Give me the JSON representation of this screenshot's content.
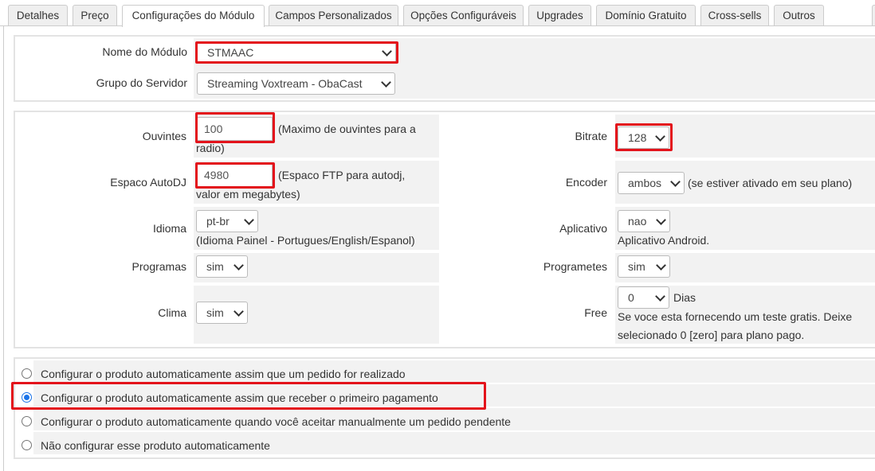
{
  "tabs": [
    {
      "label": "Detalhes",
      "active": false
    },
    {
      "label": "Preço",
      "active": false
    },
    {
      "label": "Configurações do Módulo",
      "active": true
    },
    {
      "label": "Campos Personalizados",
      "active": false
    },
    {
      "label": "Opções Configuráveis",
      "active": false
    },
    {
      "label": "Upgrades",
      "active": false
    },
    {
      "label": "Domínio Gratuito",
      "active": false
    },
    {
      "label": "Cross-sells",
      "active": false
    },
    {
      "label": "Outros",
      "active": false
    }
  ],
  "module": {
    "module_name_label": "Nome do Módulo",
    "module_name_value": "STMAAC",
    "server_group_label": "Grupo do Servidor",
    "server_group_value": "Streaming Voxtream - ObaCast"
  },
  "options": {
    "ouvintes": {
      "label": "Ouvintes",
      "value": "100",
      "help_line1": "(Maximo de ouvintes para a",
      "help_line2": "radio)"
    },
    "espaco": {
      "label": "Espaco AutoDJ",
      "value": "4980",
      "help_line1": "(Espaco FTP para autodj,",
      "help_line2": "valor em megabytes)"
    },
    "idioma": {
      "label": "Idioma",
      "value": "pt-br",
      "help": "(Idioma Painel - Portugues/English/Espanol)"
    },
    "programas": {
      "label": "Programas",
      "value": "sim"
    },
    "clima": {
      "label": "Clima",
      "value": "sim"
    },
    "bitrate": {
      "label": "Bitrate",
      "value": "128"
    },
    "encoder": {
      "label": "Encoder",
      "value": "ambos",
      "help": "(se estiver ativado em seu plano)"
    },
    "aplicativo": {
      "label": "Aplicativo",
      "value": "nao",
      "help": "Aplicativo Android."
    },
    "programetes": {
      "label": "Programetes",
      "value": "sim"
    },
    "free": {
      "label": "Free",
      "value": "0",
      "unit": "Dias",
      "help_line1": "Se voce esta fornecendo um teste gratis. Deixe",
      "help_line2": "selecionado 0 [zero] para plano pago."
    }
  },
  "setup": {
    "selected_index": 1,
    "choices": [
      "Configurar o produto automaticamente assim que um pedido for realizado",
      "Configurar o produto automaticamente assim que receber o primeiro pagamento",
      "Configurar o produto automaticamente quando você aceitar manualmente um pedido pendente",
      "Não configurar esse produto automaticamente"
    ]
  },
  "colors": {
    "highlight": "#e3131b",
    "radio_checked": "#1a73e8",
    "field_background": "#f2f2f2"
  }
}
